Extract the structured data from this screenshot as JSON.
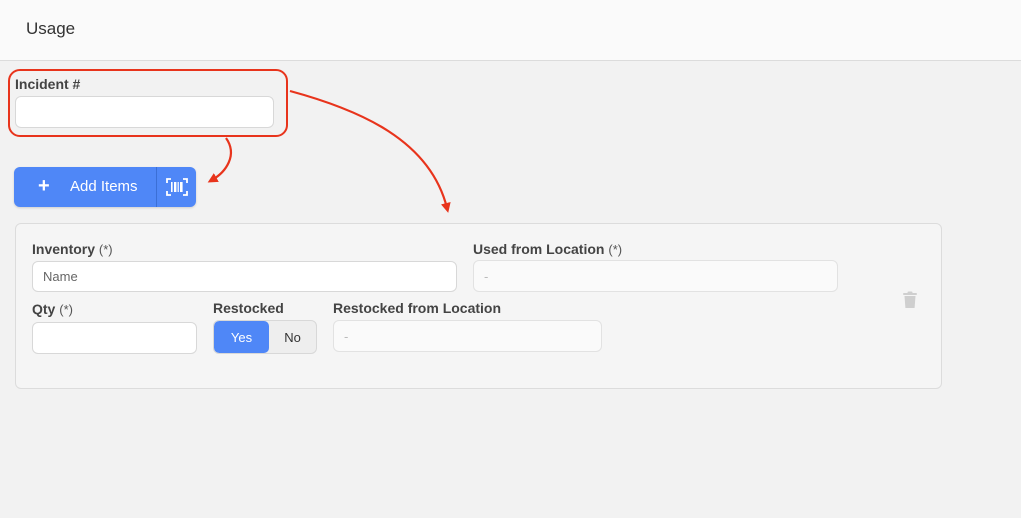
{
  "header": {
    "title": "Usage"
  },
  "incident": {
    "label": "Incident #",
    "value": ""
  },
  "add_items": {
    "label": "Add Items",
    "plus": "+",
    "scan_icon": "barcode-scan-icon"
  },
  "item": {
    "inventory": {
      "label": "Inventory",
      "required": "(*)",
      "placeholder": "Name"
    },
    "used_from_location": {
      "label": "Used from Location",
      "required": "(*)",
      "placeholder": "-"
    },
    "qty": {
      "label": "Qty",
      "required": "(*)",
      "value": ""
    },
    "restocked": {
      "label": "Restocked",
      "options": [
        "Yes",
        "No"
      ],
      "selected": "Yes"
    },
    "restocked_from_location": {
      "label": "Restocked from Location",
      "placeholder": "-"
    },
    "delete_icon": "trash-icon"
  },
  "colors": {
    "accent": "#4f87f7",
    "annotation": "#e8341c"
  }
}
